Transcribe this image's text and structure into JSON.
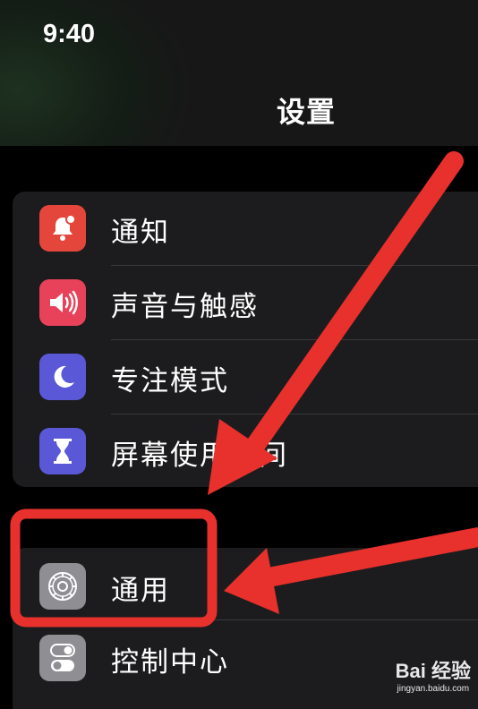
{
  "status_bar": {
    "time": "9:40"
  },
  "nav": {
    "title": "设置"
  },
  "settings": {
    "group1": [
      {
        "label": "通知",
        "icon": "bell-icon",
        "color": "#e5463c"
      },
      {
        "label": "声音与触感",
        "icon": "speaker-icon",
        "color": "#e8415a"
      },
      {
        "label": "专注模式",
        "icon": "moon-icon",
        "color": "#5a58d6"
      },
      {
        "label": "屏幕使用时间",
        "icon": "hourglass-icon",
        "color": "#5a58d6"
      }
    ],
    "group2": [
      {
        "label": "通用",
        "icon": "gear-icon",
        "color": "#8e8e93"
      },
      {
        "label": "控制中心",
        "icon": "toggle-icon",
        "color": "#8e8e93"
      }
    ]
  },
  "annotation": {
    "color": "#e8302c"
  },
  "watermark": {
    "brand": "Bai 经验",
    "url": "jingyan.baidu.com"
  }
}
